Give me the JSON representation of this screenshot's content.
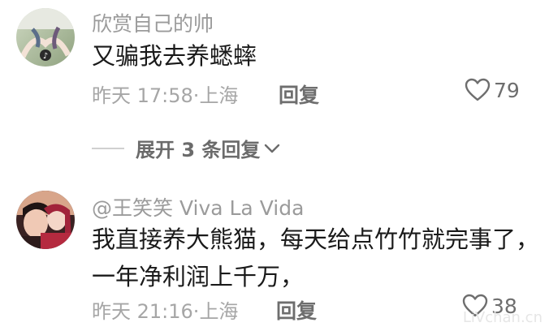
{
  "comments": [
    {
      "username": "欣赏自己的帅",
      "text_lines": [
        "又骗我去养蟋蟀"
      ],
      "date": "昨天 17:58",
      "location": "上海",
      "reply_label": "回复",
      "likes": "79",
      "avatar_icon": "tiktok-avatar-couple-hands"
    },
    {
      "username": "@王笑笑 Viva La Vida",
      "text_lines": [
        "我直接养大熊猫，每天给点竹竹就完事了，",
        "一年净利润上千万，"
      ],
      "date": "昨天 21:16",
      "location": "上海",
      "reply_label": "回复",
      "likes": "38",
      "avatar_icon": "selfie-two-people-avatar"
    }
  ],
  "expand_replies": {
    "label": "展开 3 条回复"
  },
  "watermark": "LiVchan.cn",
  "colors": {
    "meta": "#a6a6a6",
    "text": "#1a1a1a",
    "username": "#9b9b9b"
  }
}
